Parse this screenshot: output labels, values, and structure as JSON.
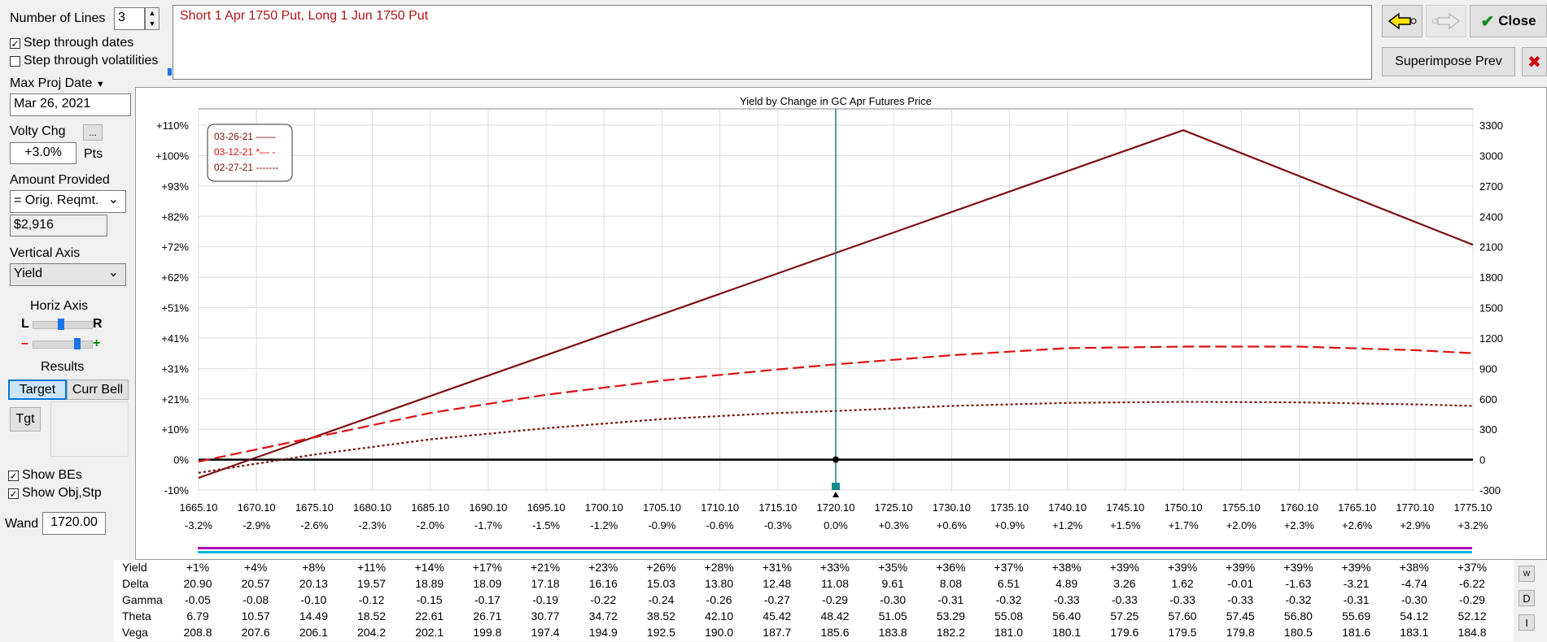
{
  "controls": {
    "number_of_lines_label": "Number of Lines",
    "number_of_lines_value": "3",
    "step_dates_label": "Step through dates",
    "step_dates_checked": true,
    "step_vols_label": "Step through volatilities",
    "step_vols_checked": false,
    "max_proj_date_label": "Max Proj Date",
    "max_proj_date_value": "Mar 26, 2021",
    "volty_chg_label": "Volty Chg",
    "volty_chg_value": "+3.0%",
    "volty_chg_unit": "Pts",
    "ellipsis_label": "...",
    "amount_provided_label": "Amount Provided",
    "amount_provided_value": "= Orig. Reqmt.",
    "amount_value": "$2,916",
    "vertical_axis_label": "Vertical Axis",
    "vertical_axis_value": "Yield",
    "horiz_axis_label": "Horiz Axis",
    "horiz_l": "L",
    "horiz_r": "R",
    "zoom_minus": "–",
    "zoom_plus": "+",
    "results_label": "Results",
    "target_tab": "Target",
    "curr_bell_tab": "Curr Bell",
    "tgt_button": "Tgt",
    "show_bes_label": "Show BEs",
    "show_bes_checked": true,
    "show_obj_label": "Show Obj,Stp",
    "show_obj_checked": true,
    "wand_label": "Wand",
    "wand_value": "1720.00"
  },
  "description": "Short 1 Apr 1750 Put, Long 1 Jun 1750 Put",
  "buttons": {
    "close": "Close",
    "superimpose": "Superimpose Prev",
    "close_x": "✖",
    "w_btn": "W",
    "d_btn": "D",
    "i_btn": "I"
  },
  "chart_data": {
    "type": "line",
    "title": "Yield by Change in GC Apr Futures Price",
    "x_ticks": [
      "1665.10",
      "1670.10",
      "1675.10",
      "1680.10",
      "1685.10",
      "1690.10",
      "1695.10",
      "1700.10",
      "1705.10",
      "1710.10",
      "1715.10",
      "1720.10",
      "1725.10",
      "1730.10",
      "1735.10",
      "1740.10",
      "1745.10",
      "1750.10",
      "1755.10",
      "1760.10",
      "1765.10",
      "1770.10",
      "1775.10"
    ],
    "x_pct_ticks": [
      "-3.2%",
      "-2.9%",
      "-2.6%",
      "-2.3%",
      "-2.0%",
      "-1.7%",
      "-1.5%",
      "-1.2%",
      "-0.9%",
      "-0.6%",
      "-0.3%",
      "0.0%",
      "+0.3%",
      "+0.6%",
      "+0.9%",
      "+1.2%",
      "+1.5%",
      "+1.7%",
      "+2.0%",
      "+2.3%",
      "+2.6%",
      "+2.9%",
      "+3.2%"
    ],
    "y_left_ticks": [
      "+110%",
      "+100%",
      "+93%",
      "+82%",
      "+72%",
      "+62%",
      "+51%",
      "+41%",
      "+31%",
      "+21%",
      "+10%",
      "0%",
      "-10%"
    ],
    "y_right_ticks": [
      "3300",
      "3000",
      "2700",
      "2400",
      "2100",
      "1800",
      "1500",
      "1200",
      "900",
      "600",
      "300",
      "0",
      "-300"
    ],
    "xlim": [
      1665.1,
      1775.1
    ],
    "ylim": [
      -300,
      3300
    ],
    "marker_x": 1720.1,
    "series": [
      {
        "name": "03-26-21",
        "legend_label": "03-26-21 ——",
        "color": "#7b0f0f",
        "dash": "solid",
        "x": [
          1665.1,
          1750.1,
          1775.1
        ],
        "y": [
          -180,
          3250,
          2120
        ]
      },
      {
        "name": "03-12-21",
        "legend_label": "03-12-21 *— -",
        "color": "#e01010",
        "dash": "dashed",
        "x": [
          1665.1,
          1675.1,
          1685.1,
          1695.1,
          1705.1,
          1715.1,
          1720.1,
          1730.1,
          1740.1,
          1750.1,
          1760.1,
          1770.1,
          1775.1
        ],
        "y": [
          -20,
          220,
          460,
          640,
          780,
          890,
          940,
          1030,
          1100,
          1115,
          1115,
          1080,
          1050
        ]
      },
      {
        "name": "02-27-21",
        "legend_label": "02-27-21 -------",
        "color": "#7b0f0f",
        "dash": "dotted",
        "x": [
          1665.1,
          1675.1,
          1685.1,
          1695.1,
          1705.1,
          1715.1,
          1720.1,
          1730.1,
          1740.1,
          1750.1,
          1760.1,
          1770.1,
          1775.1
        ],
        "y": [
          -130,
          50,
          200,
          310,
          400,
          460,
          480,
          530,
          560,
          570,
          565,
          545,
          530
        ]
      }
    ]
  },
  "greeks": {
    "rows": [
      {
        "name": "Yield",
        "values": [
          "+1%",
          "+4%",
          "+8%",
          "+11%",
          "+14%",
          "+17%",
          "+21%",
          "+23%",
          "+26%",
          "+28%",
          "+31%",
          "+33%",
          "+35%",
          "+36%",
          "+37%",
          "+38%",
          "+39%",
          "+39%",
          "+39%",
          "+39%",
          "+39%",
          "+38%",
          "+37%"
        ]
      },
      {
        "name": "Delta",
        "values": [
          "20.90",
          "20.57",
          "20.13",
          "19.57",
          "18.89",
          "18.09",
          "17.18",
          "16.16",
          "15.03",
          "13.80",
          "12.48",
          "11.08",
          "9.61",
          "8.08",
          "6.51",
          "4.89",
          "3.26",
          "1.62",
          "-0.01",
          "-1.63",
          "-3.21",
          "-4.74",
          "-6.22"
        ]
      },
      {
        "name": "Gamma",
        "values": [
          "-0.05",
          "-0.08",
          "-0.10",
          "-0.12",
          "-0.15",
          "-0.17",
          "-0.19",
          "-0.22",
          "-0.24",
          "-0.26",
          "-0.27",
          "-0.29",
          "-0.30",
          "-0.31",
          "-0.32",
          "-0.33",
          "-0.33",
          "-0.33",
          "-0.33",
          "-0.32",
          "-0.31",
          "-0.30",
          "-0.29"
        ]
      },
      {
        "name": "Theta",
        "values": [
          "6.79",
          "10.57",
          "14.49",
          "18.52",
          "22.61",
          "26.71",
          "30.77",
          "34.72",
          "38.52",
          "42.10",
          "45.42",
          "48.42",
          "51.05",
          "53.29",
          "55.08",
          "56.40",
          "57.25",
          "57.60",
          "57.45",
          "56.80",
          "55.69",
          "54.12",
          "52.12"
        ]
      },
      {
        "name": "Vega",
        "values": [
          "208.8",
          "207.6",
          "206.1",
          "204.2",
          "202.1",
          "199.8",
          "197.4",
          "194.9",
          "192.5",
          "190.0",
          "187.7",
          "185.6",
          "183.8",
          "182.2",
          "181.0",
          "180.1",
          "179.6",
          "179.5",
          "179.8",
          "180.5",
          "181.6",
          "183.1",
          "184.8"
        ]
      }
    ]
  }
}
